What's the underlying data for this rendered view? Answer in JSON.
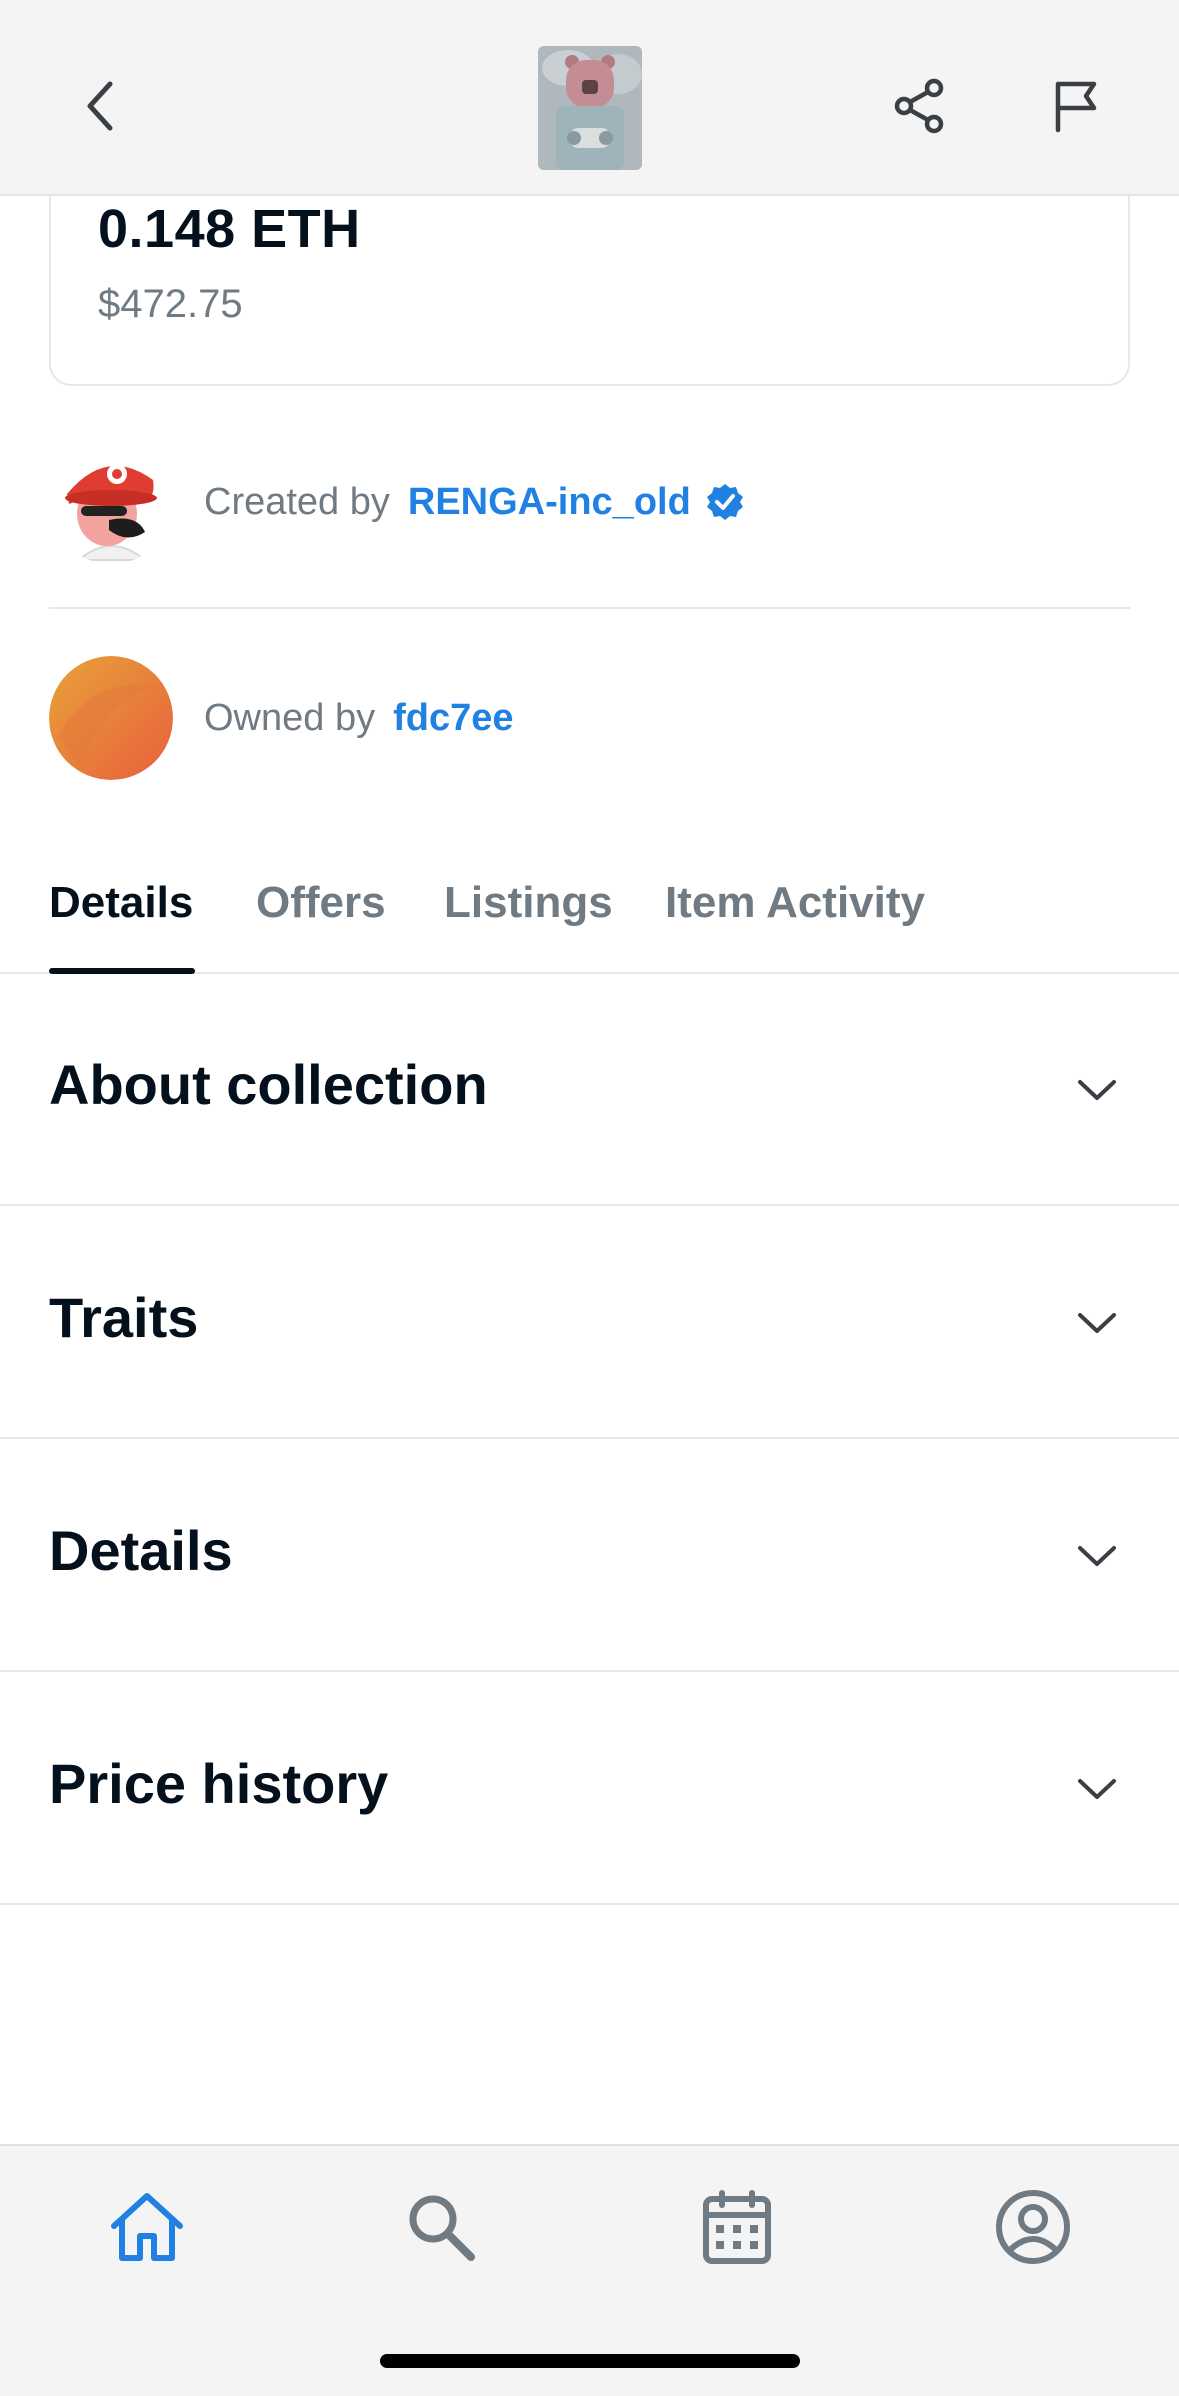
{
  "header": {
    "back_icon": "chevron-left-icon",
    "share_icon": "share-icon",
    "flag_icon": "flag-icon"
  },
  "price": {
    "eth": "0.148 ETH",
    "usd": "$472.75"
  },
  "creator": {
    "label": "Created by",
    "name": "RENGA-inc_old",
    "verified": true
  },
  "owner": {
    "label": "Owned by",
    "name": "fdc7ee"
  },
  "tabs": [
    {
      "label": "Details",
      "active": true
    },
    {
      "label": "Offers",
      "active": false
    },
    {
      "label": "Listings",
      "active": false
    },
    {
      "label": "Item Activity",
      "active": false
    }
  ],
  "sections": [
    {
      "title": "About collection"
    },
    {
      "title": "Traits"
    },
    {
      "title": "Details"
    },
    {
      "title": "Price history"
    }
  ],
  "nav": {
    "items": [
      {
        "icon": "home-icon",
        "active": true
      },
      {
        "icon": "search-icon",
        "active": false
      },
      {
        "icon": "calendar-icon",
        "active": false
      },
      {
        "icon": "account-icon",
        "active": false
      }
    ]
  },
  "colors": {
    "accent": "#2081e2",
    "text": "#04111d",
    "muted": "#707a83"
  }
}
